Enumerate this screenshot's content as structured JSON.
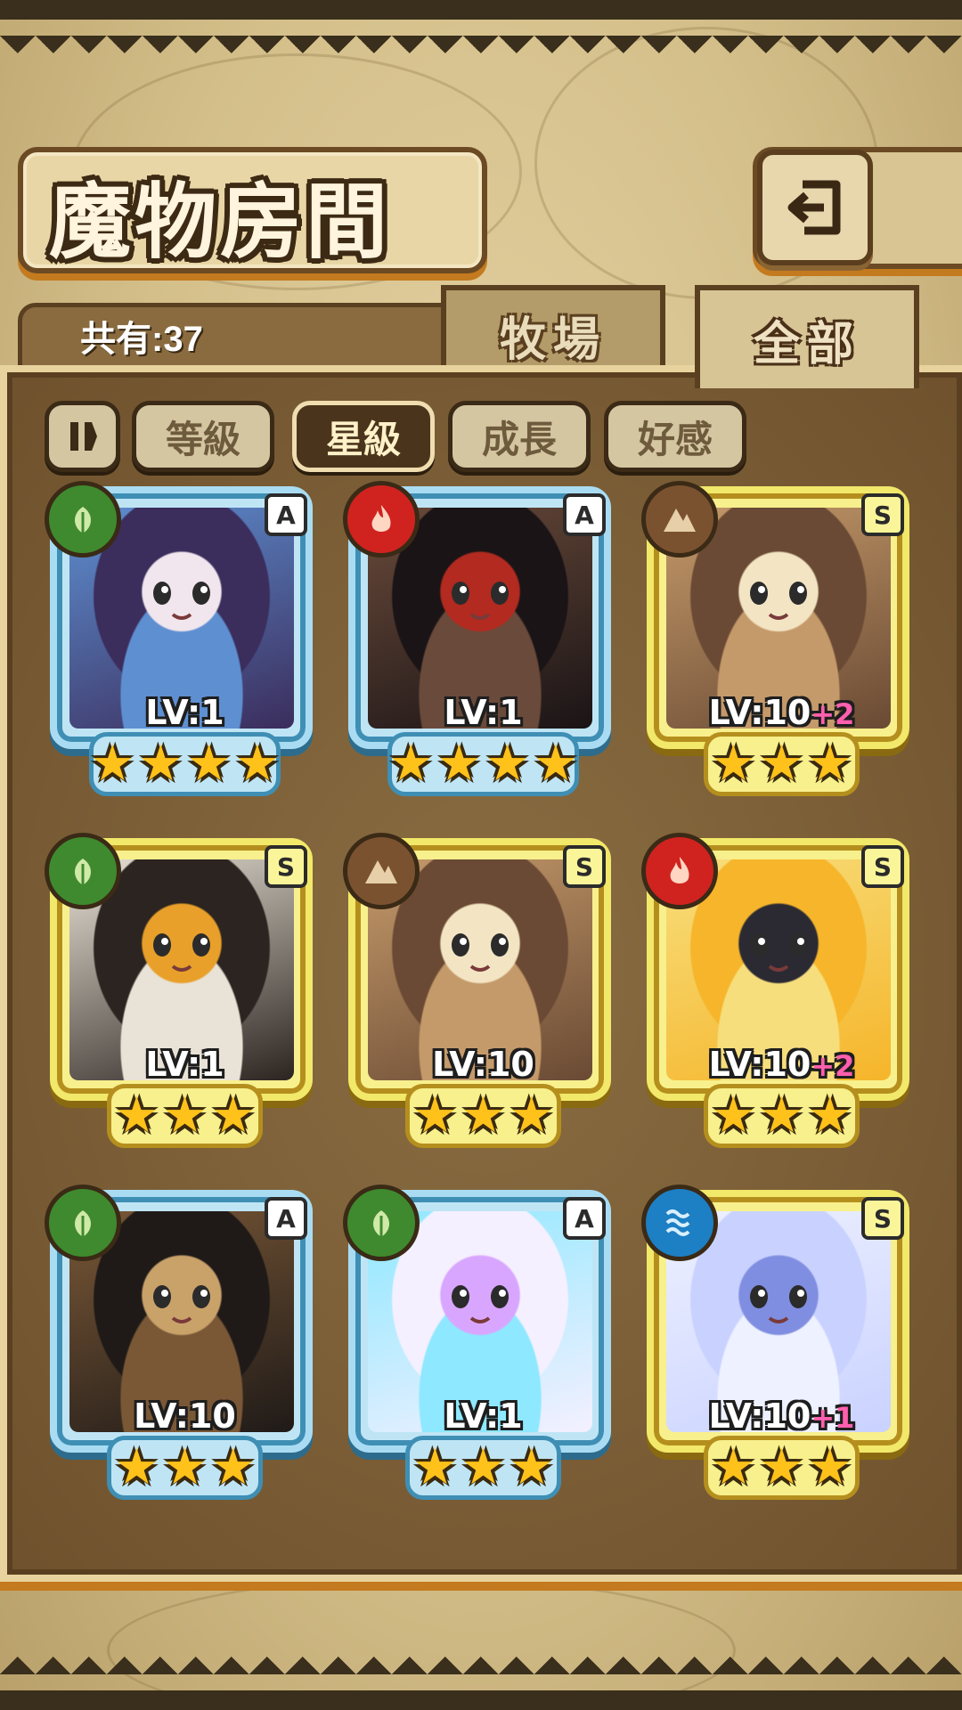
{
  "header": {
    "title": "魔物房間",
    "back_icon": "back-arrow-icon"
  },
  "tabs": {
    "count_label": "共有:37",
    "farm": "牧場",
    "all": "全部",
    "active": "all"
  },
  "sort": {
    "buttons": [
      {
        "label": "等級",
        "active": false
      },
      {
        "label": "星級",
        "active": true
      },
      {
        "label": "成長",
        "active": false
      },
      {
        "label": "好感",
        "active": false
      }
    ],
    "pause_icon": "sort-direction-icon"
  },
  "colors": {
    "frame_blue": "#a9dcf3",
    "frame_gold": "#f2e86a",
    "grass": "#3f8a2e",
    "fire": "#d0231f",
    "earth": "#7b5230",
    "water": "#1d7fc4",
    "star": "#ffc21a",
    "plus": "#ff5fae"
  },
  "monsters": [
    {
      "rank": "A",
      "element": "grass",
      "level": "LV:1",
      "plus": "",
      "stars": 4,
      "frame": "blue",
      "palette": [
        "#3b2d5c",
        "#f1e6ee",
        "#5e8fd1"
      ]
    },
    {
      "rank": "A",
      "element": "fire",
      "level": "LV:1",
      "plus": "",
      "stars": 4,
      "frame": "blue",
      "palette": [
        "#1a1416",
        "#b22a20",
        "#6a4a3a"
      ]
    },
    {
      "rank": "S",
      "element": "earth",
      "level": "LV:10",
      "plus": "+2",
      "stars": 3,
      "frame": "gold",
      "palette": [
        "#6a4a34",
        "#f3e5c4",
        "#c59a6a"
      ]
    },
    {
      "rank": "S",
      "element": "grass",
      "level": "LV:1",
      "plus": "",
      "stars": 3,
      "frame": "gold",
      "palette": [
        "#2c2420",
        "#e8a02a",
        "#e9e2d6"
      ]
    },
    {
      "rank": "S",
      "element": "earth",
      "level": "LV:10",
      "plus": "",
      "stars": 3,
      "frame": "gold",
      "palette": [
        "#6a4a34",
        "#f3e5c4",
        "#c59a6a"
      ]
    },
    {
      "rank": "S",
      "element": "fire",
      "level": "LV:10",
      "plus": "+2",
      "stars": 3,
      "frame": "gold",
      "palette": [
        "#f6b52a",
        "#2b2a33",
        "#f7de7c"
      ]
    },
    {
      "rank": "A",
      "element": "grass",
      "level": "LV:10",
      "plus": "",
      "stars": 3,
      "frame": "blue",
      "palette": [
        "#1f1a18",
        "#c9a26a",
        "#7a5836"
      ]
    },
    {
      "rank": "A",
      "element": "grass",
      "level": "LV:1",
      "plus": "",
      "stars": 3,
      "frame": "blue",
      "palette": [
        "#f4f0ff",
        "#d9a6ff",
        "#8ee8ff"
      ]
    },
    {
      "rank": "S",
      "element": "water",
      "level": "LV:10",
      "plus": "+1",
      "stars": 3,
      "frame": "gold",
      "palette": [
        "#c9d2ff",
        "#7f8ee0",
        "#eef1ff"
      ]
    }
  ]
}
